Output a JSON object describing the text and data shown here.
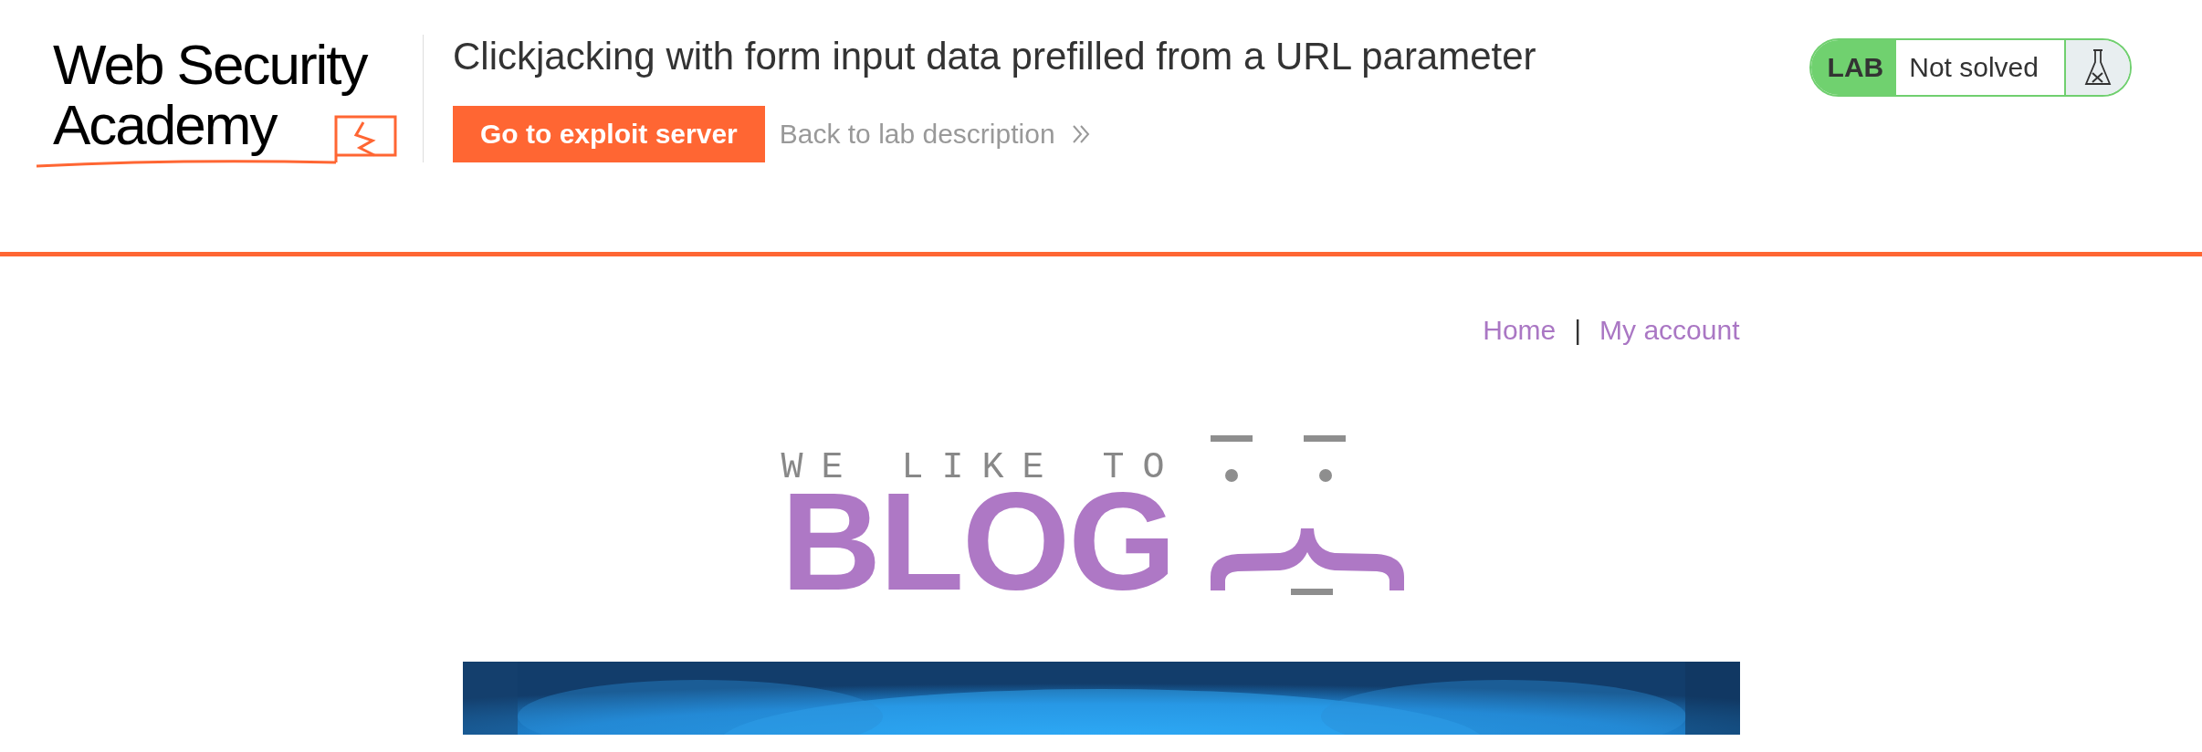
{
  "header": {
    "logo": {
      "line_1": "Web Security",
      "line_2": "Academy"
    },
    "title": "Clickjacking with form input data prefilled from a URL parameter",
    "exploit_button": "Go to exploit server",
    "back_link": "Back to lab description",
    "lab_status": {
      "label": "LAB",
      "status": "Not solved",
      "solved": false
    }
  },
  "nav": {
    "items": [
      {
        "label": "Home"
      },
      {
        "label": "My account"
      }
    ],
    "separator": "|"
  },
  "blog_logo": {
    "tagline": "WE LIKE TO",
    "title": "BLOG"
  }
}
